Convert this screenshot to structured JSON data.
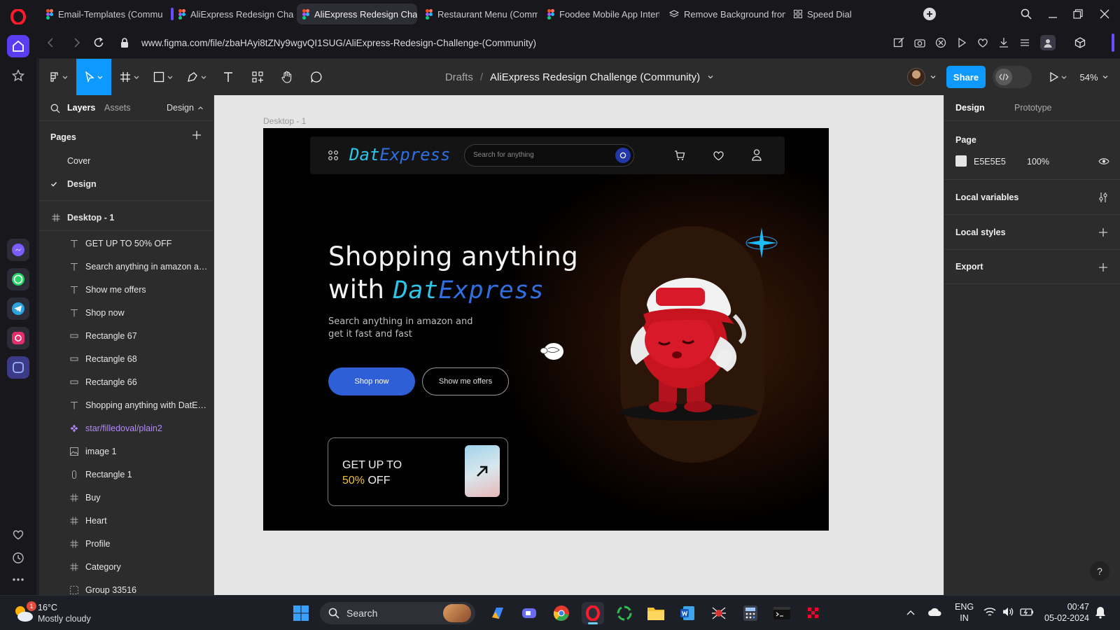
{
  "browser": {
    "tabs": [
      {
        "label": "Email-Templates (Commu",
        "icon": "figma-icon",
        "active": false
      },
      {
        "label": "AliExpress Redesign Challe",
        "icon": "figma-icon",
        "active": false
      },
      {
        "label": "AliExpress Redesign Challe",
        "icon": "figma-icon",
        "active": true
      },
      {
        "label": "Restaurant Menu (Commu",
        "icon": "figma-icon",
        "active": false
      },
      {
        "label": "Foodee Mobile App Interf",
        "icon": "figma-icon",
        "active": false
      },
      {
        "label": "Remove Background from",
        "icon": "layers-icon",
        "active": false
      },
      {
        "label": "Speed Dial",
        "icon": "grid-icon",
        "active": false
      }
    ],
    "url": "www.figma.com/file/zbaHAyi8tZNy9wgvQI1SUG/AliExpress-Redesign-Challenge-(Community)"
  },
  "figma": {
    "breadcrumb": {
      "drafts": "Drafts",
      "separator": "/",
      "file": "AliExpress Redesign Challenge (Community)"
    },
    "share_label": "Share",
    "zoom": "54%",
    "left_tabs": {
      "layers": "Layers",
      "assets": "Assets",
      "design": "Design"
    },
    "pages_heading": "Pages",
    "pages": [
      {
        "label": "Cover",
        "selected": false
      },
      {
        "label": "Design",
        "selected": true
      }
    ],
    "frame_layer": "Desktop - 1",
    "layers": [
      {
        "label": "GET UP TO 50% OFF",
        "icon": "text-icon"
      },
      {
        "label": "Search anything in amazon an...",
        "icon": "text-icon"
      },
      {
        "label": "Show me offers",
        "icon": "text-icon"
      },
      {
        "label": "Shop now",
        "icon": "text-icon"
      },
      {
        "label": "Rectangle 67",
        "icon": "rectangle-icon"
      },
      {
        "label": "Rectangle 68",
        "icon": "rectangle-icon"
      },
      {
        "label": "Rectangle 66",
        "icon": "rectangle-icon"
      },
      {
        "label": "Shopping anything with DatEx...",
        "icon": "text-icon"
      },
      {
        "label": "star/filledoval/plain2",
        "icon": "component-icon"
      },
      {
        "label": "image 1",
        "icon": "image-icon"
      },
      {
        "label": "Rectangle 1",
        "icon": "pill-icon"
      },
      {
        "label": "Buy",
        "icon": "frame-icon"
      },
      {
        "label": "Heart",
        "icon": "frame-icon"
      },
      {
        "label": "Profile",
        "icon": "frame-icon"
      },
      {
        "label": "Category",
        "icon": "frame-icon"
      },
      {
        "label": "Group 33516",
        "icon": "group-icon"
      }
    ],
    "frame_label": "Desktop - 1",
    "right_tabs": {
      "design": "Design",
      "prototype": "Prototype"
    },
    "page_section": {
      "title": "Page",
      "color": "E5E5E5",
      "opacity": "100%"
    },
    "sections": [
      "Local variables",
      "Local styles",
      "Export"
    ]
  },
  "design": {
    "logo_a": "Dat",
    "logo_b": "Express",
    "search_placeholder": "Search for anything",
    "hero_line1": "Shopping anything",
    "hero_with": "with ",
    "subtitle": "Search anything in amazon and get it fast and fast",
    "shop_now": "Shop now",
    "show_offers": "Show me offers",
    "promo_line1": "GET UP TO",
    "promo_percent": "50%",
    "promo_off": " OFF"
  },
  "taskbar": {
    "weather_temp": "16°C",
    "weather_desc": "Mostly cloudy",
    "weather_badge": "1",
    "search": "Search",
    "lang1": "ENG",
    "lang2": "IN",
    "time": "00:47",
    "date": "05-02-2024"
  },
  "colors": {
    "accent_blue": "#0d99ff",
    "logo_cyan": "#2ec4e8",
    "logo_blue": "#2f6fe0",
    "promo_yellow": "#f2c230",
    "component_purple": "#b388ff"
  }
}
